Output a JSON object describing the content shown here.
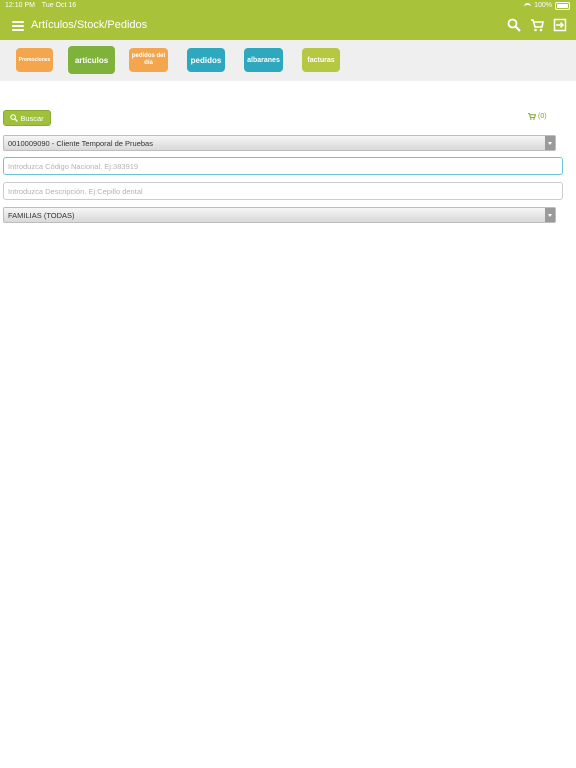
{
  "status_bar": {
    "time": "12:10 PM",
    "date": "Tue Oct 16",
    "battery": "100%"
  },
  "navbar": {
    "title": "Artículos/Stock/Pedidos"
  },
  "modules": [
    {
      "label": "Promociones"
    },
    {
      "label": "artículos"
    },
    {
      "label": "pedidos del día"
    },
    {
      "label": "pedidos"
    },
    {
      "label": "albaranes"
    },
    {
      "label": "facturas"
    }
  ],
  "search_button": {
    "label": "Buscar"
  },
  "cart": {
    "count": "(0)"
  },
  "client_select": {
    "value": "0010009090 - Cliente Temporal de Pruebas"
  },
  "code_input": {
    "placeholder": "Introduzca Código Nacional. Ej:383919",
    "value": ""
  },
  "description_input": {
    "placeholder": "Introduzca Descripción. Ej:Cepillo dental",
    "value": ""
  },
  "family_select": {
    "value": "FAMILIAS (TODAS)"
  },
  "colors": {
    "brand_green": "#a8c23a",
    "orange": "#f3a64d",
    "teal": "#2ea8bf",
    "input_focus": "#6cc4db"
  }
}
